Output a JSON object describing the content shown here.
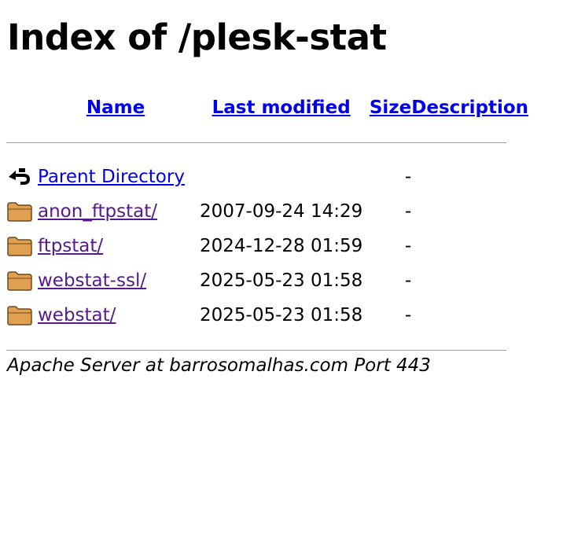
{
  "title": "Index of /plesk-stat",
  "columns": {
    "name": "Name",
    "last_modified": "Last modified",
    "size": "Size",
    "description": "Description"
  },
  "entries": [
    {
      "icon": "back-arrow-icon",
      "name": "Parent Directory",
      "last_modified": "",
      "size": "-",
      "description": ""
    },
    {
      "icon": "folder-icon",
      "name": "anon_ftpstat/",
      "last_modified": "2007-09-24 14:29",
      "size": "-",
      "description": ""
    },
    {
      "icon": "folder-icon",
      "name": "ftpstat/",
      "last_modified": "2024-12-28 01:59",
      "size": "-",
      "description": ""
    },
    {
      "icon": "folder-icon",
      "name": "webstat-ssl/",
      "last_modified": "2025-05-23 01:58",
      "size": "-",
      "description": ""
    },
    {
      "icon": "folder-icon",
      "name": "webstat/",
      "last_modified": "2025-05-23 01:58",
      "size": "-",
      "description": ""
    }
  ],
  "footer": "Apache Server at barrosomalhas.com Port 443",
  "colors": {
    "header_link": "#0000EE",
    "visited_link": "#551A8B",
    "folder_fill": "#E0A050"
  }
}
